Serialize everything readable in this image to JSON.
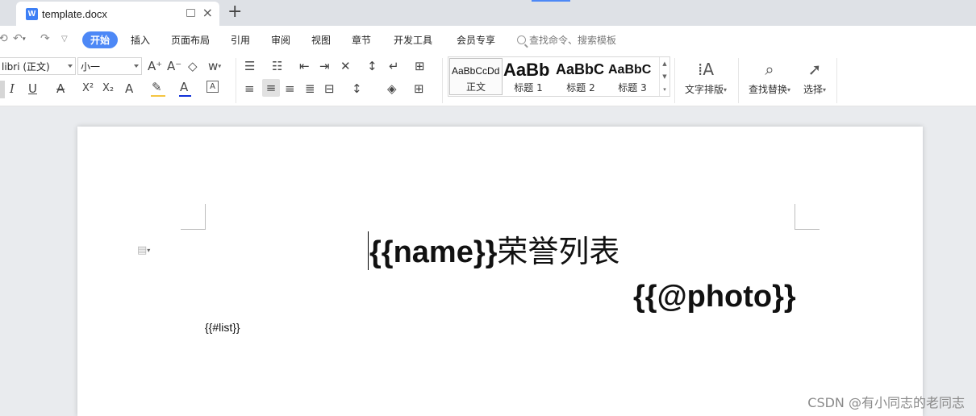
{
  "tab": {
    "title": "template.docx",
    "logo": "W",
    "close": "×",
    "new_tab": "+"
  },
  "menu": {
    "active": "开始",
    "items": [
      "插入",
      "页面布局",
      "引用",
      "审阅",
      "视图",
      "章节",
      "开发工具",
      "会员专享"
    ],
    "search_placeholder": "查找命令、搜索模板"
  },
  "ribbon": {
    "font_name": "libri (正文)",
    "font_size": "小一",
    "grow_font": "A⁺",
    "shrink_font": "A⁻",
    "italic": "I",
    "underline": "U",
    "strikethrough": "A",
    "superscript": "X²",
    "subscript": "X₂",
    "text_effect": "A",
    "highlight": "✎",
    "font_color": "A",
    "char_border": "A",
    "phonetic": "w",
    "styles": [
      {
        "sample": "AaBbCcDd",
        "name": "正文"
      },
      {
        "sample": "AaBb",
        "name": "标题 1"
      },
      {
        "sample": "AaBbC",
        "name": "标题 2"
      },
      {
        "sample": "AaBbC",
        "name": "标题 3"
      }
    ],
    "text_layout": "文字排版",
    "find_replace": "查找替换",
    "select": "选择",
    "highlight_color": "#f5c542",
    "font_color_bar": "#1030d8"
  },
  "document": {
    "title_placeholder": "{{name}}",
    "title_text": "荣誉列表",
    "photo_placeholder": "{{@photo}}",
    "list_placeholder": "{{#list}}"
  },
  "watermark": "CSDN @有小同志的老同志",
  "colors": {
    "accent": "#4d88f6"
  }
}
